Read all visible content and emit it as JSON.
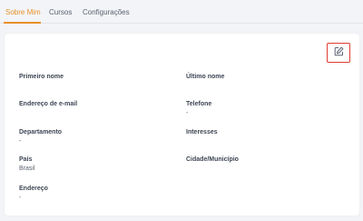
{
  "tabs": {
    "about": "Sobre Mim",
    "courses": "Cursos",
    "settings": "Configurações"
  },
  "profile": {
    "first_name": {
      "label": "Primeiro nome",
      "value": ""
    },
    "last_name": {
      "label": "Último nome",
      "value": ""
    },
    "email": {
      "label": "Endereço de e-mail",
      "value": ""
    },
    "phone": {
      "label": "Telefone",
      "value": "-"
    },
    "department": {
      "label": "Departamento",
      "value": "-"
    },
    "interests": {
      "label": "Interesses",
      "value": ""
    },
    "country": {
      "label": "País",
      "value": "Brasil"
    },
    "city": {
      "label": "Cidade/Município",
      "value": ""
    },
    "address": {
      "label": "Endereço",
      "value": "-"
    }
  },
  "icons": {
    "edit": "edit-icon"
  },
  "colors": {
    "accent": "#e8912a",
    "highlight_border": "#e03b32"
  }
}
